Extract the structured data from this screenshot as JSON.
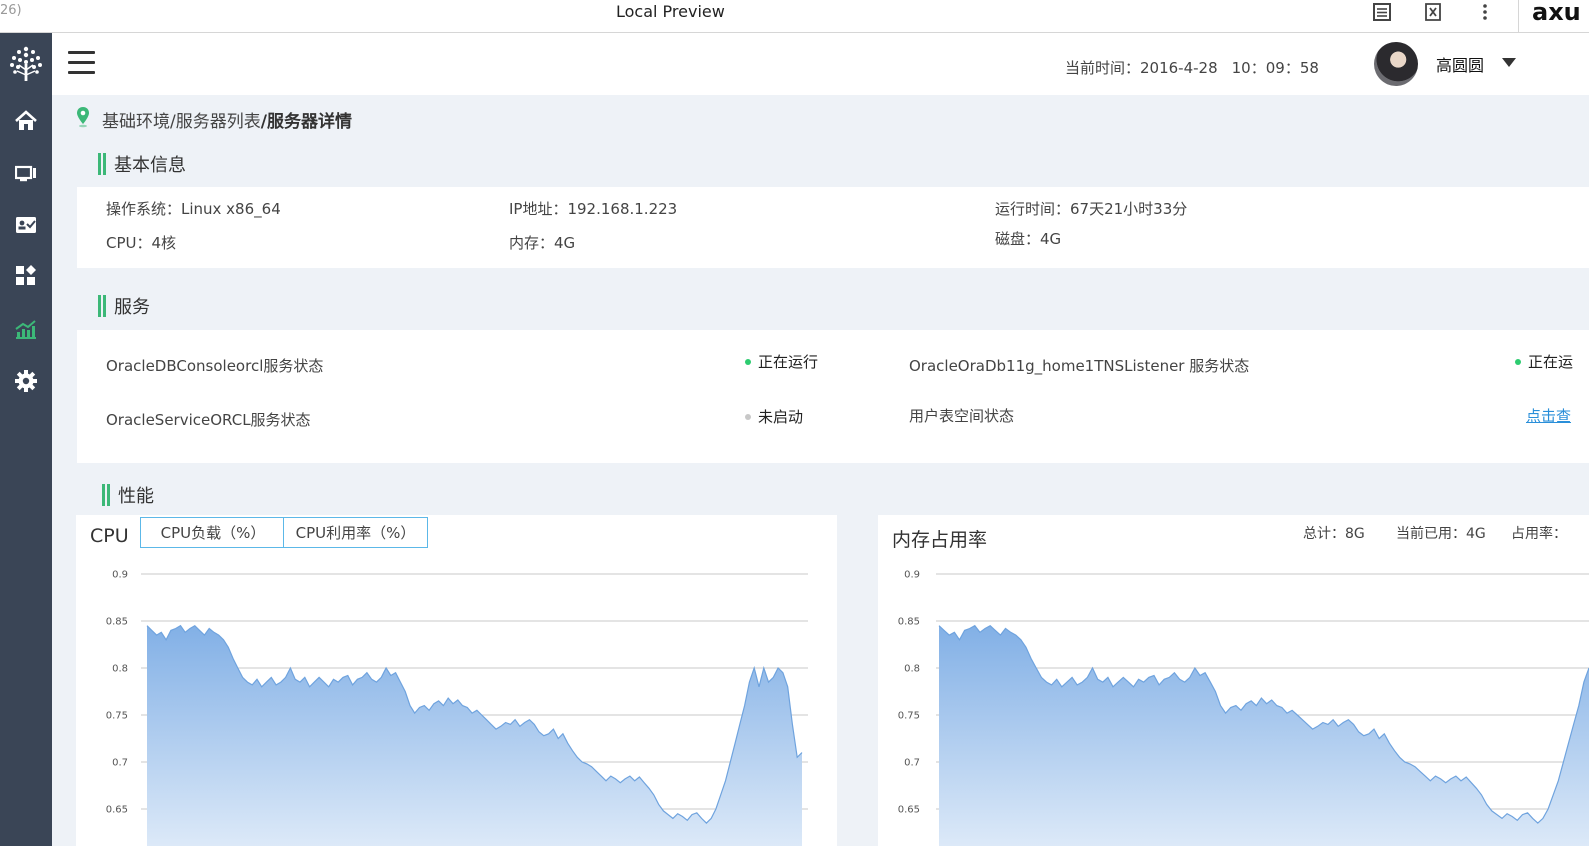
{
  "browser": {
    "title_fragment": "26)",
    "title": "Local Preview",
    "logo": "axu",
    "icons": [
      "notes-icon",
      "close-preview-icon",
      "more-icon"
    ]
  },
  "sidebar": {
    "items": [
      {
        "icon": "logo-tree-icon"
      },
      {
        "icon": "home-icon"
      },
      {
        "icon": "monitor-icon"
      },
      {
        "icon": "id-card-icon"
      },
      {
        "icon": "apps-icon"
      },
      {
        "icon": "chart-trend-icon",
        "active": true
      },
      {
        "icon": "gear-icon"
      }
    ],
    "colors": {
      "bg": "#3a4556",
      "icon": "#ffffff",
      "active": "#3cb878"
    }
  },
  "header": {
    "clock_label": "当前时间：2016-4-28",
    "clock_time": "10：09：58",
    "user_name": "高圆圆"
  },
  "breadcrumb": {
    "path": "基础环境/服务器列表",
    "current": "/服务器详情"
  },
  "basic_info": {
    "title": "基本信息",
    "os": "操作系统：Linux x86_64",
    "ip": "IP地址：192.168.1.223",
    "uptime": "运行时间：67天21小时33分",
    "cpu": "CPU：4核",
    "memory": "内存：4G",
    "disk": "磁盘：4G"
  },
  "services": {
    "title": "服务",
    "rows": [
      {
        "name": "OracleDBConsoleorcl服务状态",
        "status": "正在运行",
        "status_color": "#2dcc70"
      },
      {
        "name": "OracleOraDb11g_home1TNSListener  服务状态",
        "status": "正在运",
        "status_color": "#2dcc70"
      },
      {
        "name": "OracleServiceORCL服务状态",
        "status": "未启动",
        "status_color": "#c8c8c8"
      },
      {
        "name": "用户表空间状态",
        "link": "点击查"
      }
    ]
  },
  "performance": {
    "title": "性能",
    "cpu_panel": {
      "title": "CPU",
      "tabs": [
        "CPU负载（%）",
        "CPU利用率（%）"
      ]
    },
    "mem_panel": {
      "title": "内存占用率",
      "total": "总计：8G",
      "used": "当前已用：4G",
      "rate": "占用率："
    }
  },
  "chart_data": [
    {
      "type": "area",
      "title": "CPU",
      "ylim": [
        0.63,
        0.9
      ],
      "yticks": [
        "0.9",
        "0.85",
        "0.8",
        "0.75",
        "0.7",
        "0.65"
      ],
      "grid": true,
      "color": "#8fb8e8",
      "values": [
        0.845,
        0.84,
        0.835,
        0.838,
        0.83,
        0.84,
        0.842,
        0.845,
        0.838,
        0.842,
        0.845,
        0.84,
        0.835,
        0.842,
        0.838,
        0.835,
        0.83,
        0.822,
        0.81,
        0.8,
        0.79,
        0.785,
        0.782,
        0.788,
        0.78,
        0.785,
        0.79,
        0.782,
        0.785,
        0.79,
        0.8,
        0.788,
        0.785,
        0.79,
        0.78,
        0.785,
        0.79,
        0.785,
        0.78,
        0.788,
        0.785,
        0.79,
        0.792,
        0.782,
        0.788,
        0.79,
        0.795,
        0.788,
        0.785,
        0.79,
        0.8,
        0.792,
        0.795,
        0.785,
        0.775,
        0.76,
        0.752,
        0.758,
        0.76,
        0.755,
        0.762,
        0.765,
        0.76,
        0.768,
        0.762,
        0.766,
        0.76,
        0.758,
        0.752,
        0.755,
        0.75,
        0.745,
        0.74,
        0.735,
        0.738,
        0.742,
        0.74,
        0.745,
        0.738,
        0.742,
        0.745,
        0.74,
        0.732,
        0.728,
        0.73,
        0.735,
        0.725,
        0.73,
        0.72,
        0.712,
        0.705,
        0.7,
        0.698,
        0.695,
        0.69,
        0.685,
        0.68,
        0.685,
        0.682,
        0.678,
        0.682,
        0.685,
        0.68,
        0.684,
        0.678,
        0.672,
        0.665,
        0.655,
        0.648,
        0.644,
        0.64,
        0.645,
        0.642,
        0.638,
        0.644,
        0.646,
        0.64,
        0.635,
        0.64,
        0.65,
        0.665,
        0.68,
        0.7,
        0.72,
        0.74,
        0.76,
        0.785,
        0.8,
        0.78,
        0.8,
        0.785,
        0.79,
        0.8,
        0.795,
        0.78,
        0.74,
        0.705,
        0.71
      ]
    },
    {
      "type": "area",
      "title": "内存占用率",
      "ylim": [
        0.63,
        0.9
      ],
      "yticks": [
        "0.9",
        "0.85",
        "0.8",
        "0.75",
        "0.7",
        "0.65"
      ],
      "grid": true,
      "color": "#8fb8e8",
      "values": [
        0.845,
        0.84,
        0.835,
        0.838,
        0.83,
        0.84,
        0.842,
        0.845,
        0.838,
        0.842,
        0.845,
        0.84,
        0.835,
        0.842,
        0.838,
        0.835,
        0.83,
        0.822,
        0.81,
        0.8,
        0.79,
        0.785,
        0.782,
        0.788,
        0.78,
        0.785,
        0.79,
        0.782,
        0.785,
        0.79,
        0.8,
        0.788,
        0.785,
        0.79,
        0.78,
        0.785,
        0.79,
        0.785,
        0.78,
        0.788,
        0.785,
        0.79,
        0.792,
        0.782,
        0.788,
        0.79,
        0.795,
        0.788,
        0.785,
        0.79,
        0.8,
        0.792,
        0.795,
        0.785,
        0.775,
        0.76,
        0.752,
        0.758,
        0.76,
        0.755,
        0.762,
        0.765,
        0.76,
        0.768,
        0.762,
        0.766,
        0.76,
        0.758,
        0.752,
        0.755,
        0.75,
        0.745,
        0.74,
        0.735,
        0.738,
        0.742,
        0.74,
        0.745,
        0.738,
        0.742,
        0.745,
        0.74,
        0.732,
        0.728,
        0.73,
        0.735,
        0.725,
        0.73,
        0.72,
        0.712,
        0.705,
        0.7,
        0.698,
        0.695,
        0.69,
        0.685,
        0.68,
        0.685,
        0.682,
        0.678,
        0.682,
        0.685,
        0.68,
        0.684,
        0.678,
        0.672,
        0.665,
        0.655,
        0.648,
        0.644,
        0.64,
        0.645,
        0.642,
        0.638,
        0.644,
        0.646,
        0.64,
        0.635,
        0.64,
        0.65,
        0.665,
        0.68,
        0.7,
        0.72,
        0.74,
        0.76,
        0.785,
        0.8
      ]
    }
  ]
}
